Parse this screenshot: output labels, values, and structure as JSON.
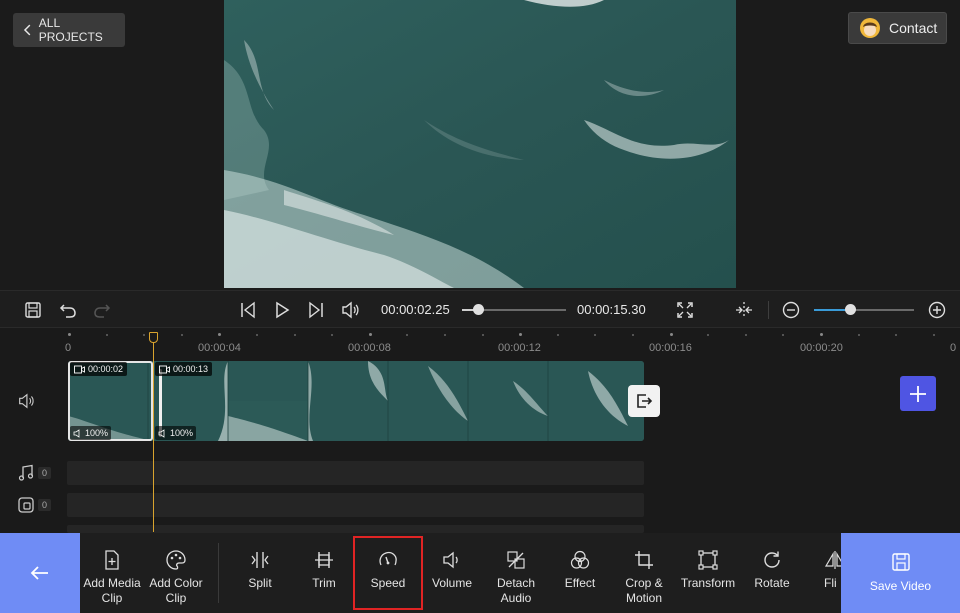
{
  "header": {
    "back_label": "ALL PROJECTS",
    "contact_label": "Contact"
  },
  "player": {
    "current_time": "00:00:02.25",
    "total_time": "00:00:15.30",
    "seek_progress": 0.15,
    "zoom_level": 0.36
  },
  "timeline": {
    "ruler_labels": [
      "0",
      "00:00:04",
      "00:00:08",
      "00:00:12",
      "00:00:16",
      "00:00:20",
      "0"
    ],
    "clips": [
      {
        "duration": "00:00:02",
        "volume": "100%"
      },
      {
        "duration": "00:00:13",
        "volume": "100%"
      }
    ],
    "audio_track_count": "0",
    "overlay_track_count": "0"
  },
  "toolbar": {
    "tools": [
      {
        "id": "add-media-clip",
        "label": "Add Media\nClip",
        "icon": "add-file-icon"
      },
      {
        "id": "add-color-clip",
        "label": "Add Color\nClip",
        "icon": "palette-icon"
      },
      {
        "id": "split",
        "label": "Split",
        "icon": "split-icon"
      },
      {
        "id": "trim",
        "label": "Trim",
        "icon": "trim-icon"
      },
      {
        "id": "speed",
        "label": "Speed",
        "icon": "speedometer-icon"
      },
      {
        "id": "volume",
        "label": "Volume",
        "icon": "volume-icon"
      },
      {
        "id": "detach-audio",
        "label": "Detach\nAudio",
        "icon": "detach-audio-icon"
      },
      {
        "id": "effect",
        "label": "Effect",
        "icon": "effect-icon"
      },
      {
        "id": "crop-motion",
        "label": "Crop &\nMotion",
        "icon": "crop-icon"
      },
      {
        "id": "transform",
        "label": "Transform",
        "icon": "transform-icon"
      },
      {
        "id": "rotate",
        "label": "Rotate",
        "icon": "rotate-icon"
      },
      {
        "id": "flip",
        "label": "Fli",
        "icon": "flip-icon"
      }
    ],
    "save_label": "Save Video"
  },
  "colors": {
    "accent_blue": "#6f8cf5",
    "add_track": "#4f55e3",
    "playhead": "#d8a32e",
    "highlight_red": "#e02424",
    "zoom_fill": "#3a9bd8"
  }
}
